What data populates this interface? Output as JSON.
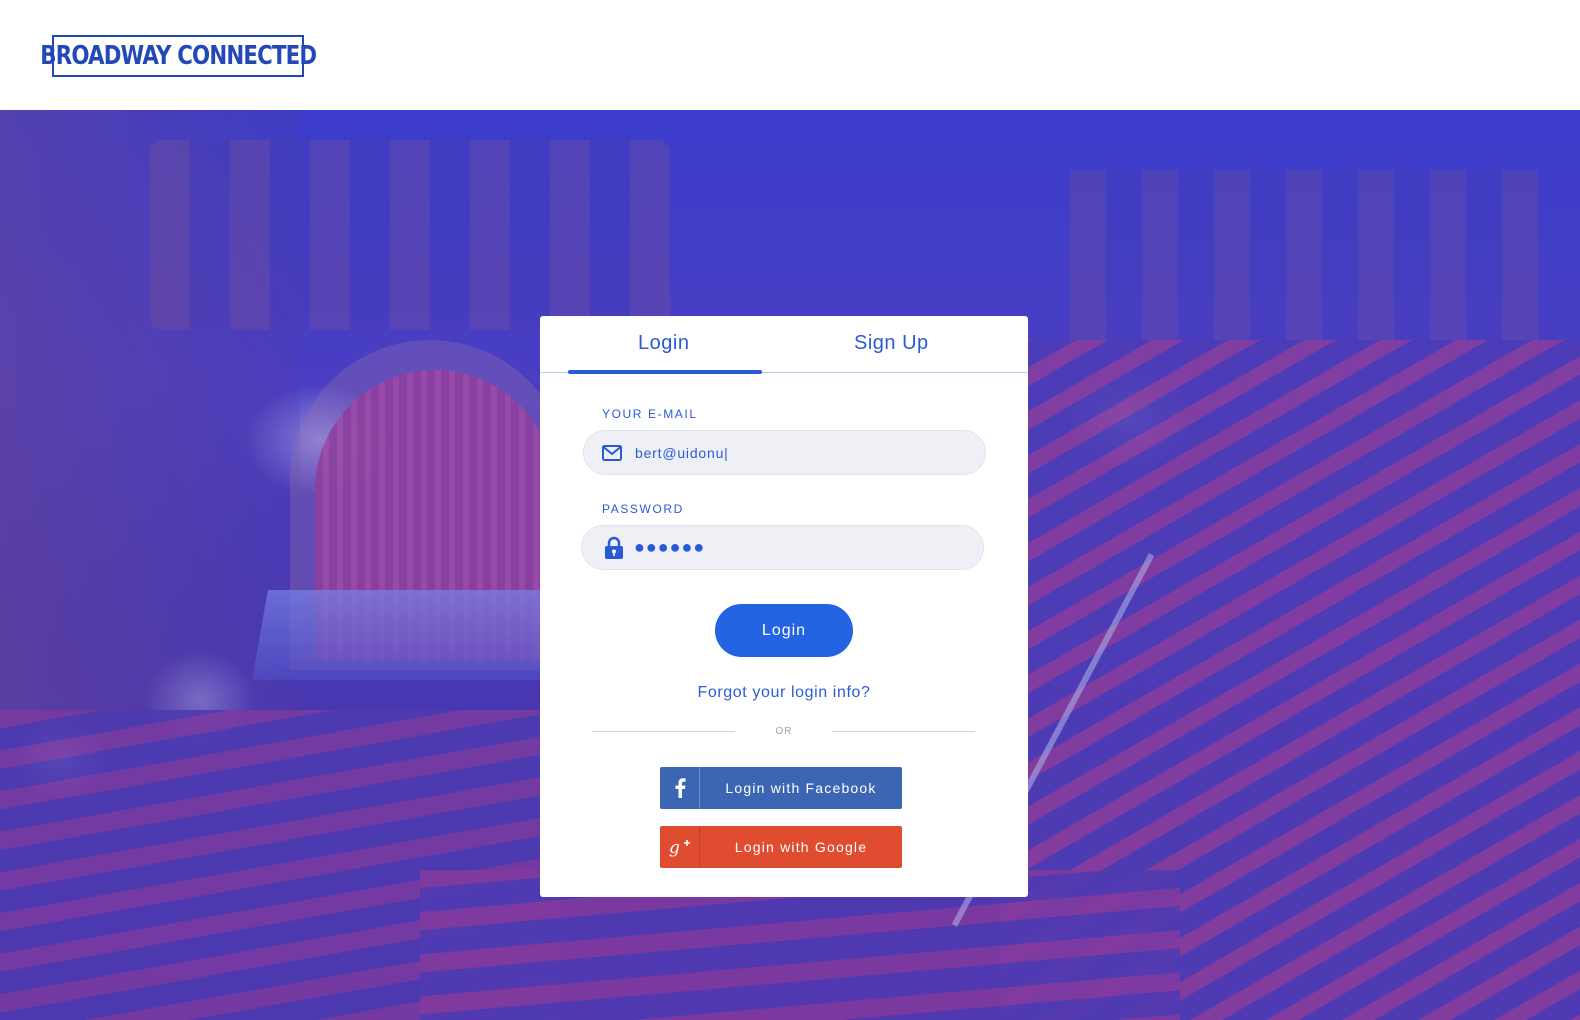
{
  "brand": {
    "logo_text": "BROADWAY CONNECTED"
  },
  "tabs": [
    {
      "label": "Login",
      "active": true
    },
    {
      "label": "Sign Up",
      "active": false
    }
  ],
  "form": {
    "email": {
      "label": "YOUR E-MAIL",
      "value": "bert@uidonu|",
      "icon": "mail-icon"
    },
    "password": {
      "label": "PASSWORD",
      "value": "●●●●●●",
      "icon": "lock-icon"
    },
    "submit_label": "Login",
    "forgot_label": "Forgot your login info?",
    "divider_label": "OR"
  },
  "social": {
    "facebook": {
      "label": "Login with Facebook",
      "icon": "facebook-icon",
      "color": "#3c66b3"
    },
    "google": {
      "label": "Login with Google",
      "icon": "google-plus-icon",
      "color": "#e04c30"
    }
  },
  "colors": {
    "accent": "#2a5bd7",
    "button": "#2463e2",
    "background_tint": "#3b3fd0"
  }
}
